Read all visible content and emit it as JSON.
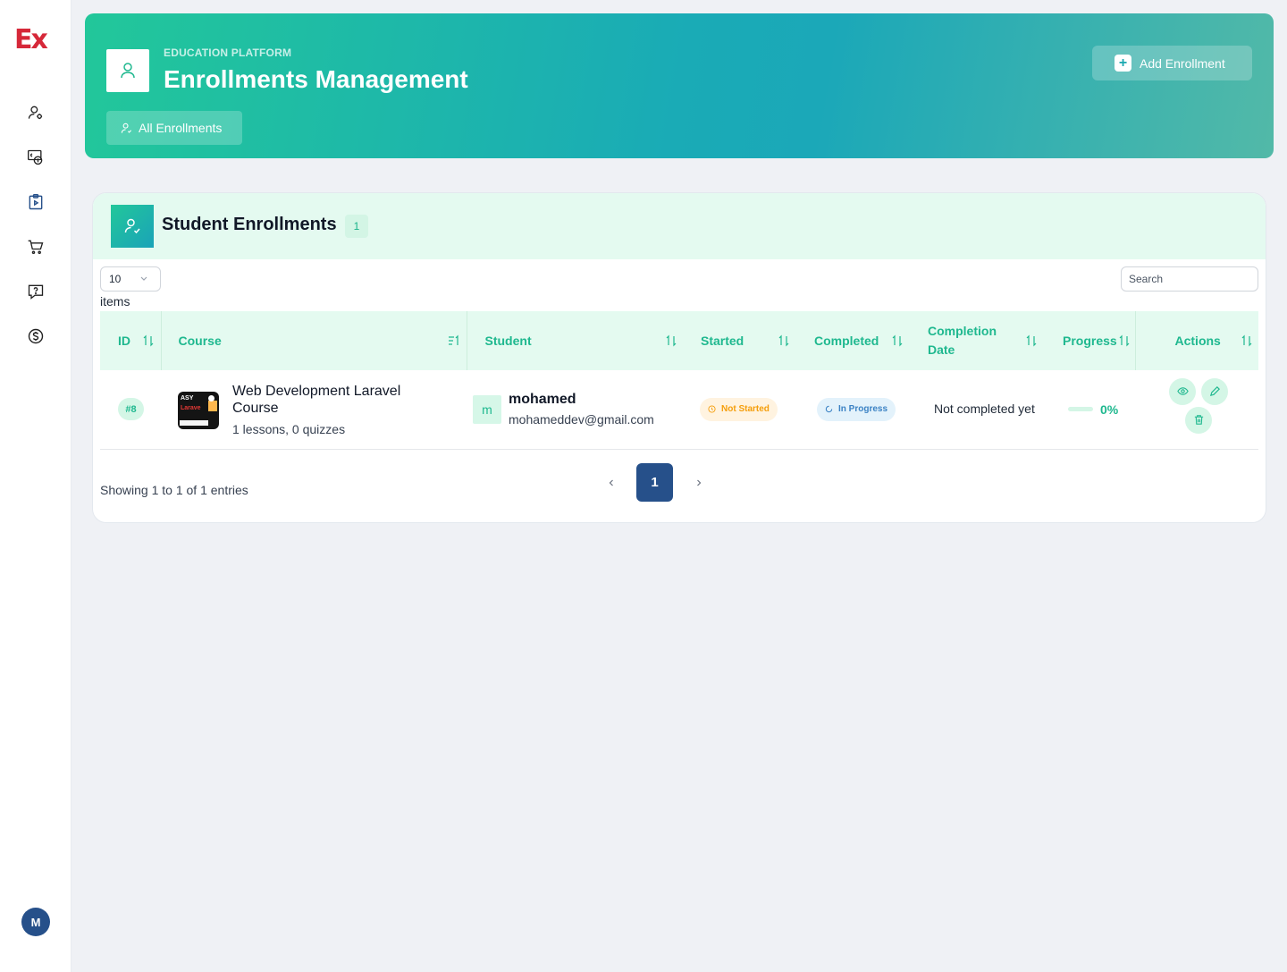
{
  "brand": {
    "logo_text": "Ex",
    "logo_color": "#d62839"
  },
  "sidebar": {
    "items": [
      {
        "icon": "user-cog-icon"
      },
      {
        "icon": "money-transfer-icon"
      },
      {
        "icon": "course-clipboard-icon",
        "active": true
      },
      {
        "icon": "cart-icon"
      },
      {
        "icon": "help-message-icon"
      },
      {
        "icon": "dollar-circle-icon"
      }
    ],
    "user_initial": "M"
  },
  "header": {
    "kicker": "EDUCATION PLATFORM",
    "title": "Enrollments Management",
    "tab_label": "All Enrollments",
    "add_button": "Add Enrollment"
  },
  "card": {
    "title": "Student Enrollments",
    "count": "1",
    "page_size": "10",
    "items_label": "items",
    "search_placeholder": "Search"
  },
  "table": {
    "columns": [
      "ID",
      "Course",
      "Student",
      "Started",
      "Completed",
      "Completion Date",
      "Progress",
      "Actions"
    ],
    "rows": [
      {
        "id": "#8",
        "course_name": "Web Development Laravel Course",
        "course_meta": "1 lessons, 0 quizzes",
        "student_initial": "m",
        "student_name": "mohamed",
        "student_email": "mohameddev@gmail.com",
        "started": "Not Started",
        "completed": "In Progress",
        "completion_date": "Not completed yet",
        "progress_label": "0%",
        "progress_fraction": 0
      }
    ]
  },
  "footer": {
    "showing": "Showing 1 to 1 of 1 entries",
    "current_page": "1"
  },
  "colors": {
    "accent": "#1fb88f",
    "primary_dark": "#26508a",
    "warning": "#f59e0b",
    "info": "#3b82c4"
  }
}
